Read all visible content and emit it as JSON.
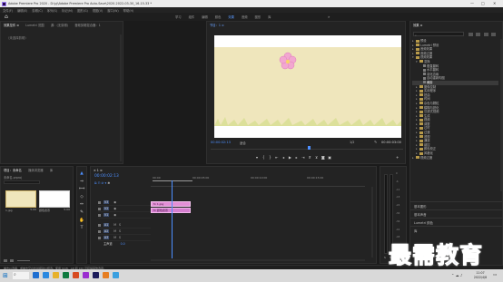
{
  "window": {
    "title": "Adobe Premiere Pro 2020 - D:\\pj\\Adobe Premiere Pro Auto-Save\\2020-2022-03-30_16-15-33 *",
    "controls": [
      "—",
      "□",
      "✕"
    ]
  },
  "menu": [
    "文件(F)",
    "编辑(E)",
    "剪辑(C)",
    "序列(S)",
    "标记(M)",
    "图形(G)",
    "视图(V)",
    "窗口(W)",
    "帮助(H)"
  ],
  "workspaces": {
    "items": [
      "学习",
      "组件",
      "编辑",
      "颜色",
      "效果",
      "音频",
      "图形",
      "库"
    ],
    "active_index": 4,
    "more": "»"
  },
  "effect_controls": {
    "tabs": [
      "效果控件 ≡",
      "Lumetri 范围",
      "源：(无剪辑)",
      "音频剪辑混合器：1"
    ],
    "empty_text": "（未选择剪辑）"
  },
  "program_monitor": {
    "tab": "节目：1 ≡",
    "timecode": "00:00:02:13",
    "fit": "适合",
    "quality": "1/2",
    "duration": "00:00:03:00",
    "colors": {
      "sky": "#ffffff",
      "meadow": "#efe6bc",
      "grass": "#d9df96",
      "flower": "#f2a7d0"
    }
  },
  "project_panel": {
    "tabs": [
      "项目：未命名",
      "媒体浏览器",
      "库"
    ],
    "project_file": "未命名.prproj",
    "items": [
      {
        "name": "1.jpg",
        "duration": "5:00"
      },
      {
        "name": "颜色遮罩",
        "duration": "5:00"
      }
    ]
  },
  "timeline": {
    "tab": "× 1 ≡",
    "timecode": "00:00:02:13",
    "ruler": [
      "00:00",
      "00:00:05:00",
      "00:00:10:00",
      "00:00:15:00"
    ],
    "video_tracks": [
      "V3",
      "V2",
      "V1"
    ],
    "audio_tracks": [
      "A1",
      "A2",
      "A3"
    ],
    "master": {
      "label": "主声道",
      "value": "0.0"
    },
    "clips": [
      {
        "track": "V2",
        "name": "1.jpg",
        "color": "#e38fd6"
      },
      {
        "track": "V1",
        "name": "颜色遮罩",
        "color": "#d67fd0"
      }
    ],
    "meter_scale": [
      "0",
      "-6",
      "-12",
      "-18",
      "-24",
      "-30",
      "-36",
      "-42",
      "-48",
      "-54",
      "dB"
    ]
  },
  "effects_panel": {
    "tab": "效果 ≡",
    "tree": [
      {
        "label": "预设",
        "level": 0,
        "open": false
      },
      {
        "label": "Lumetri 预设",
        "level": 0,
        "open": false
      },
      {
        "label": "音频效果",
        "level": 0,
        "open": false
      },
      {
        "label": "音频过渡",
        "level": 0,
        "open": false
      },
      {
        "label": "视频效果",
        "level": 0,
        "open": true
      },
      {
        "label": "变换",
        "level": 1,
        "open": true
      },
      {
        "label": "垂直翻转",
        "level": 2,
        "open": null
      },
      {
        "label": "水平翻转",
        "level": 2,
        "open": null
      },
      {
        "label": "羽化边缘",
        "level": 2,
        "open": null
      },
      {
        "label": "自动重新构图",
        "level": 2,
        "open": null
      },
      {
        "label": "裁剪",
        "level": 2,
        "open": null,
        "selected": true
      },
      {
        "label": "图像控制",
        "level": 1,
        "open": false
      },
      {
        "label": "实用程序",
        "level": 1,
        "open": false
      },
      {
        "label": "扭曲",
        "level": 1,
        "open": false
      },
      {
        "label": "时间",
        "level": 1,
        "open": false
      },
      {
        "label": "杂色与颗粒",
        "level": 1,
        "open": false
      },
      {
        "label": "模糊与锐化",
        "level": 1,
        "open": false
      },
      {
        "label": "沉浸式视频",
        "level": 1,
        "open": false
      },
      {
        "label": "生成",
        "level": 1,
        "open": false
      },
      {
        "label": "视频",
        "level": 1,
        "open": false
      },
      {
        "label": "调整",
        "level": 1,
        "open": false
      },
      {
        "label": "过时",
        "level": 1,
        "open": false
      },
      {
        "label": "过渡",
        "level": 1,
        "open": false
      },
      {
        "label": "透视",
        "level": 1,
        "open": false
      },
      {
        "label": "通道",
        "level": 1,
        "open": false
      },
      {
        "label": "键控",
        "level": 1,
        "open": false
      },
      {
        "label": "颜色校正",
        "level": 1,
        "open": false
      },
      {
        "label": "风格化",
        "level": 1,
        "open": false
      },
      {
        "label": "视频过渡",
        "level": 0,
        "open": false
      }
    ],
    "sections": [
      "基本图形",
      "基本声音",
      "Lumetri 颜色",
      "库"
    ]
  },
  "status_bar": {
    "text": "单击以选择，或单击空白处并拖动以框选。使用 Shift、Alt 和 Ctrl 可获得其他选项。"
  },
  "taskbar": {
    "search": "",
    "clock_time": "11:07",
    "clock_date": "2022/4/8",
    "icon_colors": [
      "#1f6fd1",
      "#2b89e0",
      "#e7b12b",
      "#0f7a3f",
      "#d74b21",
      "#9b2fd0",
      "#1b1b5a",
      "#e67e22",
      "#3aa0e0"
    ]
  },
  "watermark": "最需教育"
}
